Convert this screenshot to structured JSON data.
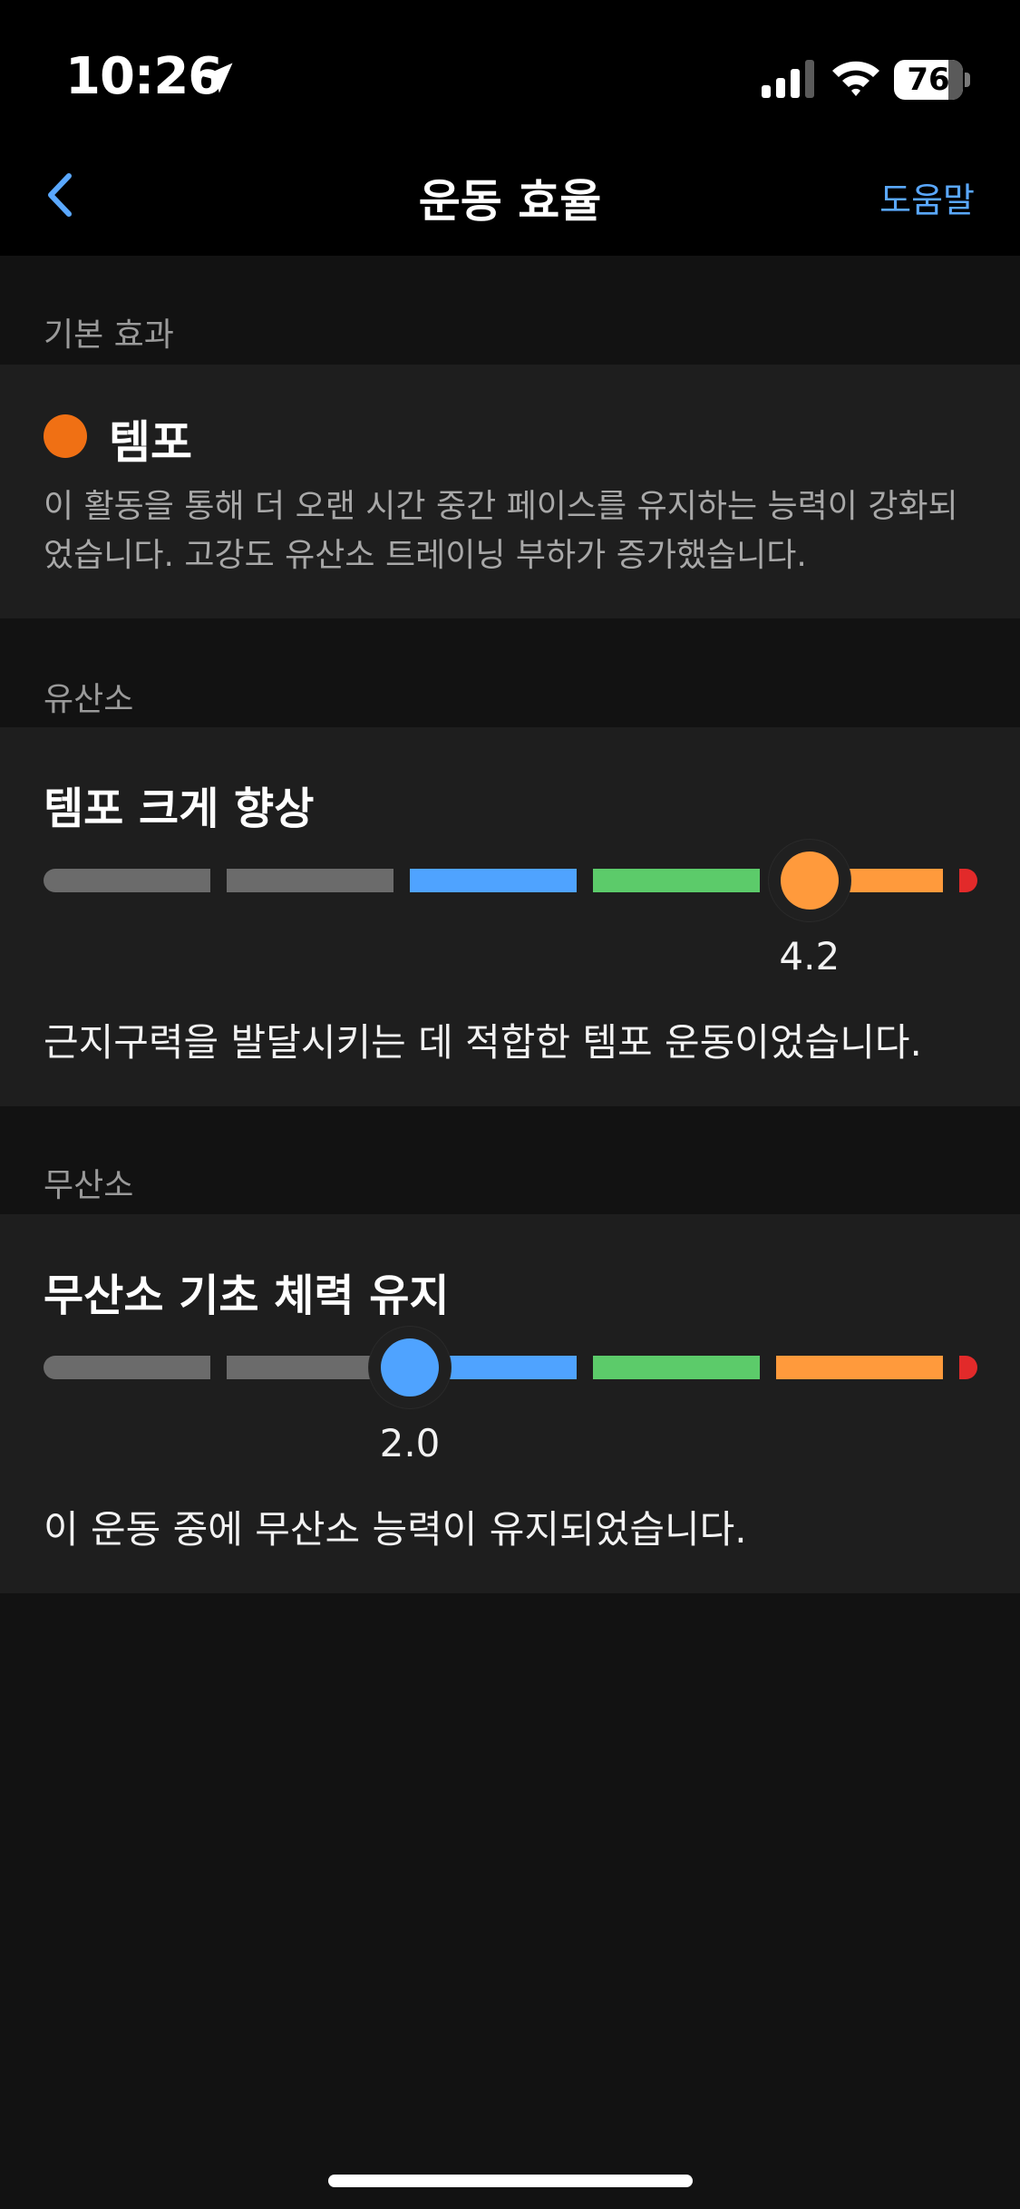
{
  "status_bar": {
    "time": "10:26",
    "battery": "76",
    "icons": [
      "location-arrow-icon",
      "cellular-signal-icon",
      "wifi-icon",
      "battery-icon"
    ]
  },
  "nav": {
    "title": "운동 효율",
    "help": "도움말",
    "back_icon": "chevron-left-icon"
  },
  "primary_effect": {
    "header": "기본 효과",
    "title": "템포",
    "dot_color": "#f07014",
    "description": "이 활동을 통해 더 오랜 시간 중간 페이스를 유지하는 능력이 강화되었습니다. 고강도 유산소 트레이닝 부하가 증가했습니다."
  },
  "aerobic": {
    "header": "유산소",
    "title": "템포 크게 향상",
    "value": 4.2,
    "value_label": "4.2",
    "thumb_color": "#ff9a3c",
    "description": "근지구력을 발달시키는 데 적합한 템포 운동이었습니다."
  },
  "anaerobic": {
    "header": "무산소",
    "title": "무산소 기초 체력 유지",
    "value": 2.0,
    "value_label": "2.0",
    "thumb_color": "#4fa3ff",
    "description": "이 운동 중에 무산소 능력이 유지되었습니다."
  },
  "scale": {
    "min": 0,
    "max": 5.0,
    "segment_colors": [
      "#6b6b6b",
      "#6b6b6b",
      "#4fa3ff",
      "#5ccb6a",
      "#ff9a3c",
      "#e22a2a"
    ]
  }
}
